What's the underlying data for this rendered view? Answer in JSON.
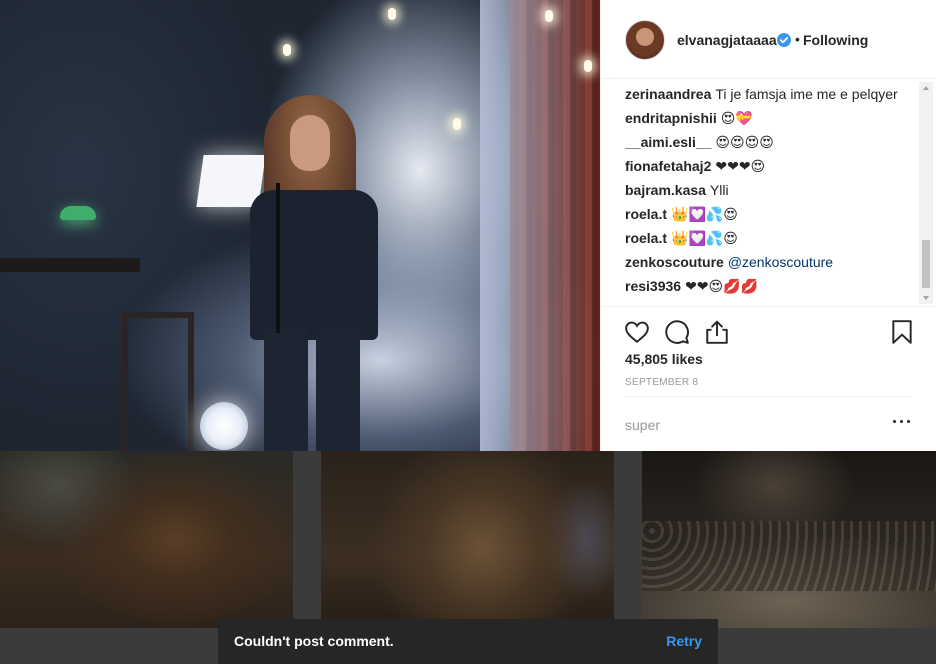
{
  "post": {
    "username": "elvanagjataaaa",
    "follow_separator": "•",
    "follow_status": "Following",
    "comments": [
      {
        "user": "zerinaandrea",
        "text": "Ti je famsja ime me e pelqyer"
      },
      {
        "user": "endritapnishii",
        "text": "😍💝"
      },
      {
        "user": "__aimi.esli__",
        "text": "😍😍😍😍"
      },
      {
        "user": "fionafetahaj2",
        "text": "❤❤❤😍"
      },
      {
        "user": "bajram.kasa",
        "text": "Ylli"
      },
      {
        "user": "roela.t",
        "text": "👑💟💦😍"
      },
      {
        "user": "roela.t",
        "text": "👑💟💦😍"
      },
      {
        "user": "zenkoscouture",
        "text": "@zenkoscouture"
      },
      {
        "user": "resi3936",
        "text": "❤❤😍💋💋"
      }
    ],
    "likes": "45,805 likes",
    "date": "SEPTEMBER 8",
    "comment_input_value": "super"
  },
  "toast": {
    "message": "Couldn't post comment.",
    "action": "Retry"
  },
  "colors": {
    "link_blue": "#3897f0",
    "mention": "#003569",
    "verified_badge": "#3897f0"
  }
}
